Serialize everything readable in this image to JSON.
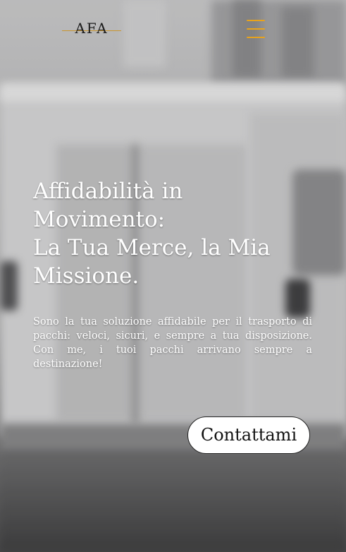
{
  "header": {
    "logo_text": "AFA",
    "menu_icon": "hamburger-menu-icon",
    "accent_color": "#e8a31c"
  },
  "hero": {
    "headline_lines": [
      "Affidabilità in",
      "Movimento:",
      "La Tua Merce, la Mia",
      "Missione."
    ],
    "intro": "Sono la tua soluzione affidabile per il trasporto di pacchi: veloci, sicuri, e sempre a tua disposizione. Con me, i tuoi pacchi arrivano sempre a destinazione!",
    "cta_label": "Contattami"
  }
}
